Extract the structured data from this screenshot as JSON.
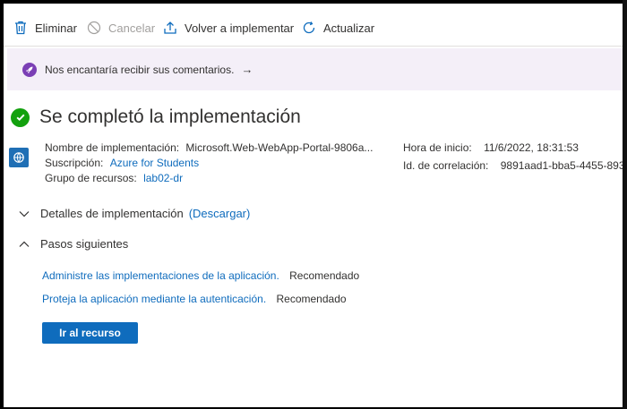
{
  "toolbar": {
    "delete_label": "Eliminar",
    "cancel_label": "Cancelar",
    "redeploy_label": "Volver a implementar",
    "refresh_label": "Actualizar"
  },
  "banner": {
    "text": "Nos encantaría recibir sus comentarios.",
    "arrow": "→"
  },
  "title": "Se completó la implementación",
  "details": {
    "deployment_name_label": "Nombre de implementación:",
    "deployment_name_value": "Microsoft.Web-WebApp-Portal-9806a...",
    "subscription_label": "Suscripción:",
    "subscription_value": "Azure for Students",
    "resource_group_label": "Grupo de recursos:",
    "resource_group_value": "lab02-dr",
    "start_time_label": "Hora de inicio:",
    "start_time_value": "11/6/2022, 18:31:53",
    "correlation_label": "Id. de correlación:",
    "correlation_value": "9891aad1-bba5-4455-893"
  },
  "sections": {
    "deployment_details": "Detalles de implementación",
    "download": "(Descargar)",
    "next_steps": "Pasos siguientes"
  },
  "next_steps": [
    {
      "link": "Administre las implementaciones de la aplicación.",
      "tag": "Recomendado"
    },
    {
      "link": "Proteja la aplicación mediante la autenticación.",
      "tag": "Recomendado"
    }
  ],
  "go_to_resource": "Ir al recurso",
  "colors": {
    "accent": "#0f6cbd",
    "success": "#13a10e",
    "banner_bg": "#f4eff8",
    "banner_icon": "#7b3fb5"
  }
}
